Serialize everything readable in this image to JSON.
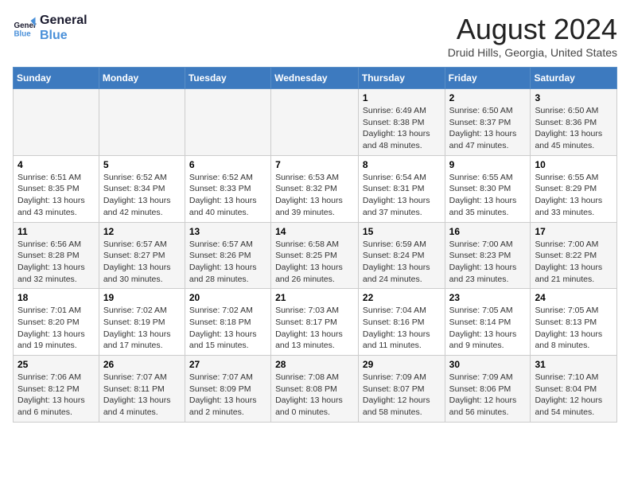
{
  "header": {
    "logo_line1": "General",
    "logo_line2": "Blue",
    "month_title": "August 2024",
    "location": "Druid Hills, Georgia, United States"
  },
  "weekdays": [
    "Sunday",
    "Monday",
    "Tuesday",
    "Wednesday",
    "Thursday",
    "Friday",
    "Saturday"
  ],
  "weeks": [
    [
      {
        "day": "",
        "info": ""
      },
      {
        "day": "",
        "info": ""
      },
      {
        "day": "",
        "info": ""
      },
      {
        "day": "",
        "info": ""
      },
      {
        "day": "1",
        "sunrise": "6:49 AM",
        "sunset": "8:38 PM",
        "daylight": "13 hours and 48 minutes."
      },
      {
        "day": "2",
        "sunrise": "6:50 AM",
        "sunset": "8:37 PM",
        "daylight": "13 hours and 47 minutes."
      },
      {
        "day": "3",
        "sunrise": "6:50 AM",
        "sunset": "8:36 PM",
        "daylight": "13 hours and 45 minutes."
      }
    ],
    [
      {
        "day": "4",
        "sunrise": "6:51 AM",
        "sunset": "8:35 PM",
        "daylight": "13 hours and 43 minutes."
      },
      {
        "day": "5",
        "sunrise": "6:52 AM",
        "sunset": "8:34 PM",
        "daylight": "13 hours and 42 minutes."
      },
      {
        "day": "6",
        "sunrise": "6:52 AM",
        "sunset": "8:33 PM",
        "daylight": "13 hours and 40 minutes."
      },
      {
        "day": "7",
        "sunrise": "6:53 AM",
        "sunset": "8:32 PM",
        "daylight": "13 hours and 39 minutes."
      },
      {
        "day": "8",
        "sunrise": "6:54 AM",
        "sunset": "8:31 PM",
        "daylight": "13 hours and 37 minutes."
      },
      {
        "day": "9",
        "sunrise": "6:55 AM",
        "sunset": "8:30 PM",
        "daylight": "13 hours and 35 minutes."
      },
      {
        "day": "10",
        "sunrise": "6:55 AM",
        "sunset": "8:29 PM",
        "daylight": "13 hours and 33 minutes."
      }
    ],
    [
      {
        "day": "11",
        "sunrise": "6:56 AM",
        "sunset": "8:28 PM",
        "daylight": "13 hours and 32 minutes."
      },
      {
        "day": "12",
        "sunrise": "6:57 AM",
        "sunset": "8:27 PM",
        "daylight": "13 hours and 30 minutes."
      },
      {
        "day": "13",
        "sunrise": "6:57 AM",
        "sunset": "8:26 PM",
        "daylight": "13 hours and 28 minutes."
      },
      {
        "day": "14",
        "sunrise": "6:58 AM",
        "sunset": "8:25 PM",
        "daylight": "13 hours and 26 minutes."
      },
      {
        "day": "15",
        "sunrise": "6:59 AM",
        "sunset": "8:24 PM",
        "daylight": "13 hours and 24 minutes."
      },
      {
        "day": "16",
        "sunrise": "7:00 AM",
        "sunset": "8:23 PM",
        "daylight": "13 hours and 23 minutes."
      },
      {
        "day": "17",
        "sunrise": "7:00 AM",
        "sunset": "8:22 PM",
        "daylight": "13 hours and 21 minutes."
      }
    ],
    [
      {
        "day": "18",
        "sunrise": "7:01 AM",
        "sunset": "8:20 PM",
        "daylight": "13 hours and 19 minutes."
      },
      {
        "day": "19",
        "sunrise": "7:02 AM",
        "sunset": "8:19 PM",
        "daylight": "13 hours and 17 minutes."
      },
      {
        "day": "20",
        "sunrise": "7:02 AM",
        "sunset": "8:18 PM",
        "daylight": "13 hours and 15 minutes."
      },
      {
        "day": "21",
        "sunrise": "7:03 AM",
        "sunset": "8:17 PM",
        "daylight": "13 hours and 13 minutes."
      },
      {
        "day": "22",
        "sunrise": "7:04 AM",
        "sunset": "8:16 PM",
        "daylight": "13 hours and 11 minutes."
      },
      {
        "day": "23",
        "sunrise": "7:05 AM",
        "sunset": "8:14 PM",
        "daylight": "13 hours and 9 minutes."
      },
      {
        "day": "24",
        "sunrise": "7:05 AM",
        "sunset": "8:13 PM",
        "daylight": "13 hours and 8 minutes."
      }
    ],
    [
      {
        "day": "25",
        "sunrise": "7:06 AM",
        "sunset": "8:12 PM",
        "daylight": "13 hours and 6 minutes."
      },
      {
        "day": "26",
        "sunrise": "7:07 AM",
        "sunset": "8:11 PM",
        "daylight": "13 hours and 4 minutes."
      },
      {
        "day": "27",
        "sunrise": "7:07 AM",
        "sunset": "8:09 PM",
        "daylight": "13 hours and 2 minutes."
      },
      {
        "day": "28",
        "sunrise": "7:08 AM",
        "sunset": "8:08 PM",
        "daylight": "13 hours and 0 minutes."
      },
      {
        "day": "29",
        "sunrise": "7:09 AM",
        "sunset": "8:07 PM",
        "daylight": "12 hours and 58 minutes."
      },
      {
        "day": "30",
        "sunrise": "7:09 AM",
        "sunset": "8:06 PM",
        "daylight": "12 hours and 56 minutes."
      },
      {
        "day": "31",
        "sunrise": "7:10 AM",
        "sunset": "8:04 PM",
        "daylight": "12 hours and 54 minutes."
      }
    ]
  ],
  "labels": {
    "sunrise": "Sunrise:",
    "sunset": "Sunset:",
    "daylight": "Daylight:"
  }
}
